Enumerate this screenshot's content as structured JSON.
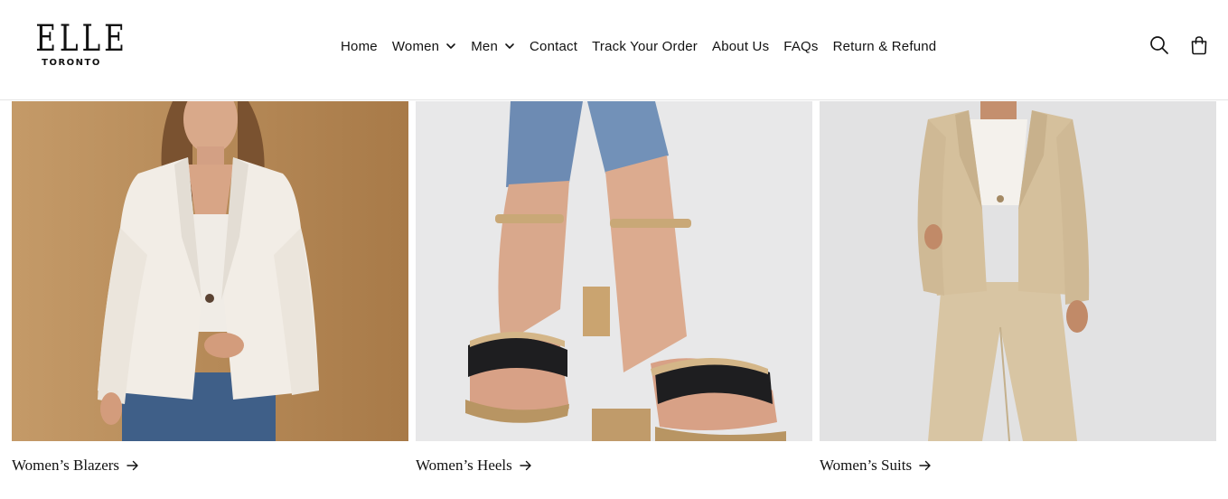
{
  "brand": {
    "name": "ELLE",
    "city": "TORONTO"
  },
  "nav": {
    "items": [
      {
        "label": "Home",
        "dropdown": false
      },
      {
        "label": "Women",
        "dropdown": true
      },
      {
        "label": "Men",
        "dropdown": true
      },
      {
        "label": "Contact",
        "dropdown": false
      },
      {
        "label": "Track Your Order",
        "dropdown": false
      },
      {
        "label": "About Us",
        "dropdown": false
      },
      {
        "label": "FAQs",
        "dropdown": false
      },
      {
        "label": "Return & Refund",
        "dropdown": false
      }
    ]
  },
  "header_icons": [
    "search-icon",
    "cart-icon"
  ],
  "collections": [
    {
      "title": "Women’s Blazers",
      "image": "woman-white-blazer-photo",
      "bg": "#b88c5c"
    },
    {
      "title": "Women’s Heels",
      "image": "gold-strappy-heels-photo",
      "bg": "#e8e8e8"
    },
    {
      "title": "Women’s Suits",
      "image": "woman-beige-suit-photo",
      "bg": "#e2e2e2"
    }
  ]
}
